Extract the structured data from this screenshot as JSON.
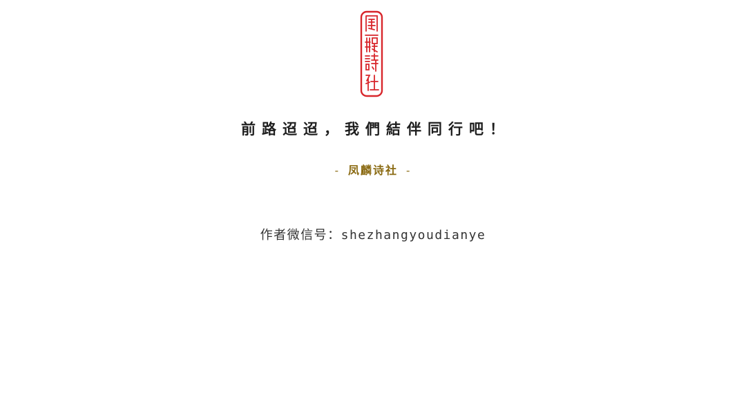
{
  "seal": {
    "text": "鳳麟詩社",
    "color": "#d8262b"
  },
  "headline": "前路迢迢，我們結伴同行吧！",
  "signature": {
    "dash_left": "-",
    "name": "凤麟诗社",
    "dash_right": "-",
    "color": "#8a6a12"
  },
  "author": {
    "label": "作者微信号：",
    "wechat_id": "shezhangyoudianye"
  }
}
